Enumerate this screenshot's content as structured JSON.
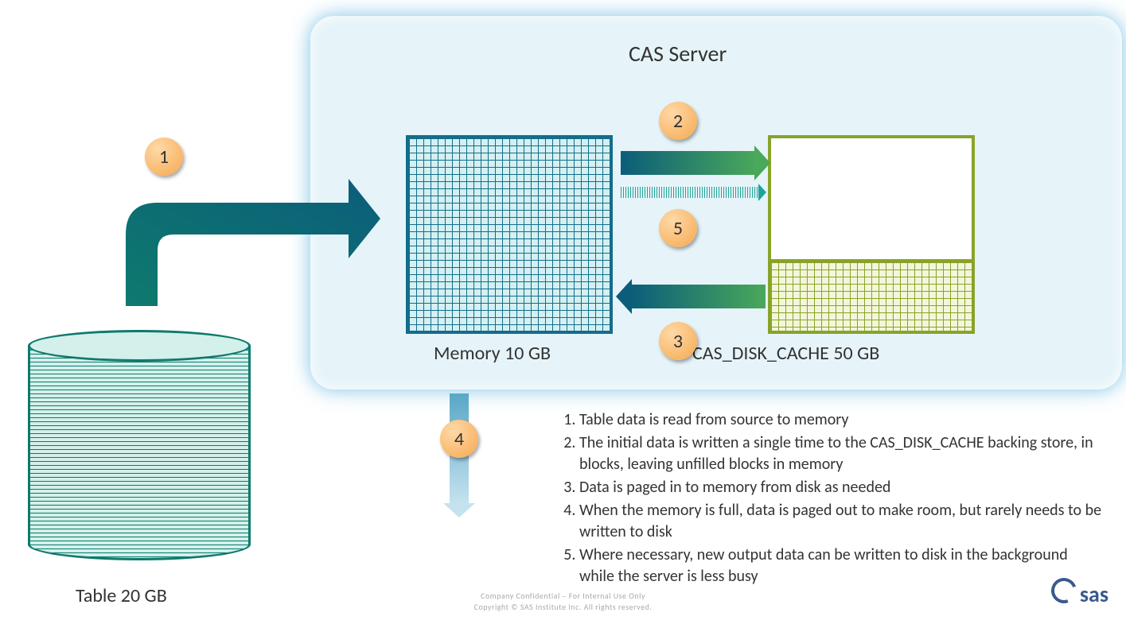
{
  "server": {
    "title": "CAS Server",
    "memory_label": "Memory 10 GB",
    "cache_label": "CAS_DISK_CACHE 50 GB"
  },
  "source": {
    "label": "Table 20 GB"
  },
  "badges": {
    "b1": "1",
    "b2": "2",
    "b3": "3",
    "b4": "4",
    "b5": "5"
  },
  "steps": [
    "Table data is read from source to memory",
    "The initial data is written a single time to the CAS_DISK_CACHE backing store, in blocks, leaving unfilled blocks in memory",
    "Data is paged in to memory from disk as needed",
    "When the memory is full, data is paged out to make room, but rarely needs to be written to disk",
    "Where necessary, new output data can be written to disk in the background while the server is less busy"
  ],
  "footer": {
    "line1": "Company Confidential – For Internal Use Only",
    "line2": "Copyright © SAS Institute Inc. All rights reserved."
  },
  "logo": "sas",
  "colors": {
    "teal": "#136d8b",
    "green": "#88a32a",
    "orange": "#f5a84e",
    "sky": "#e6f4f9"
  }
}
